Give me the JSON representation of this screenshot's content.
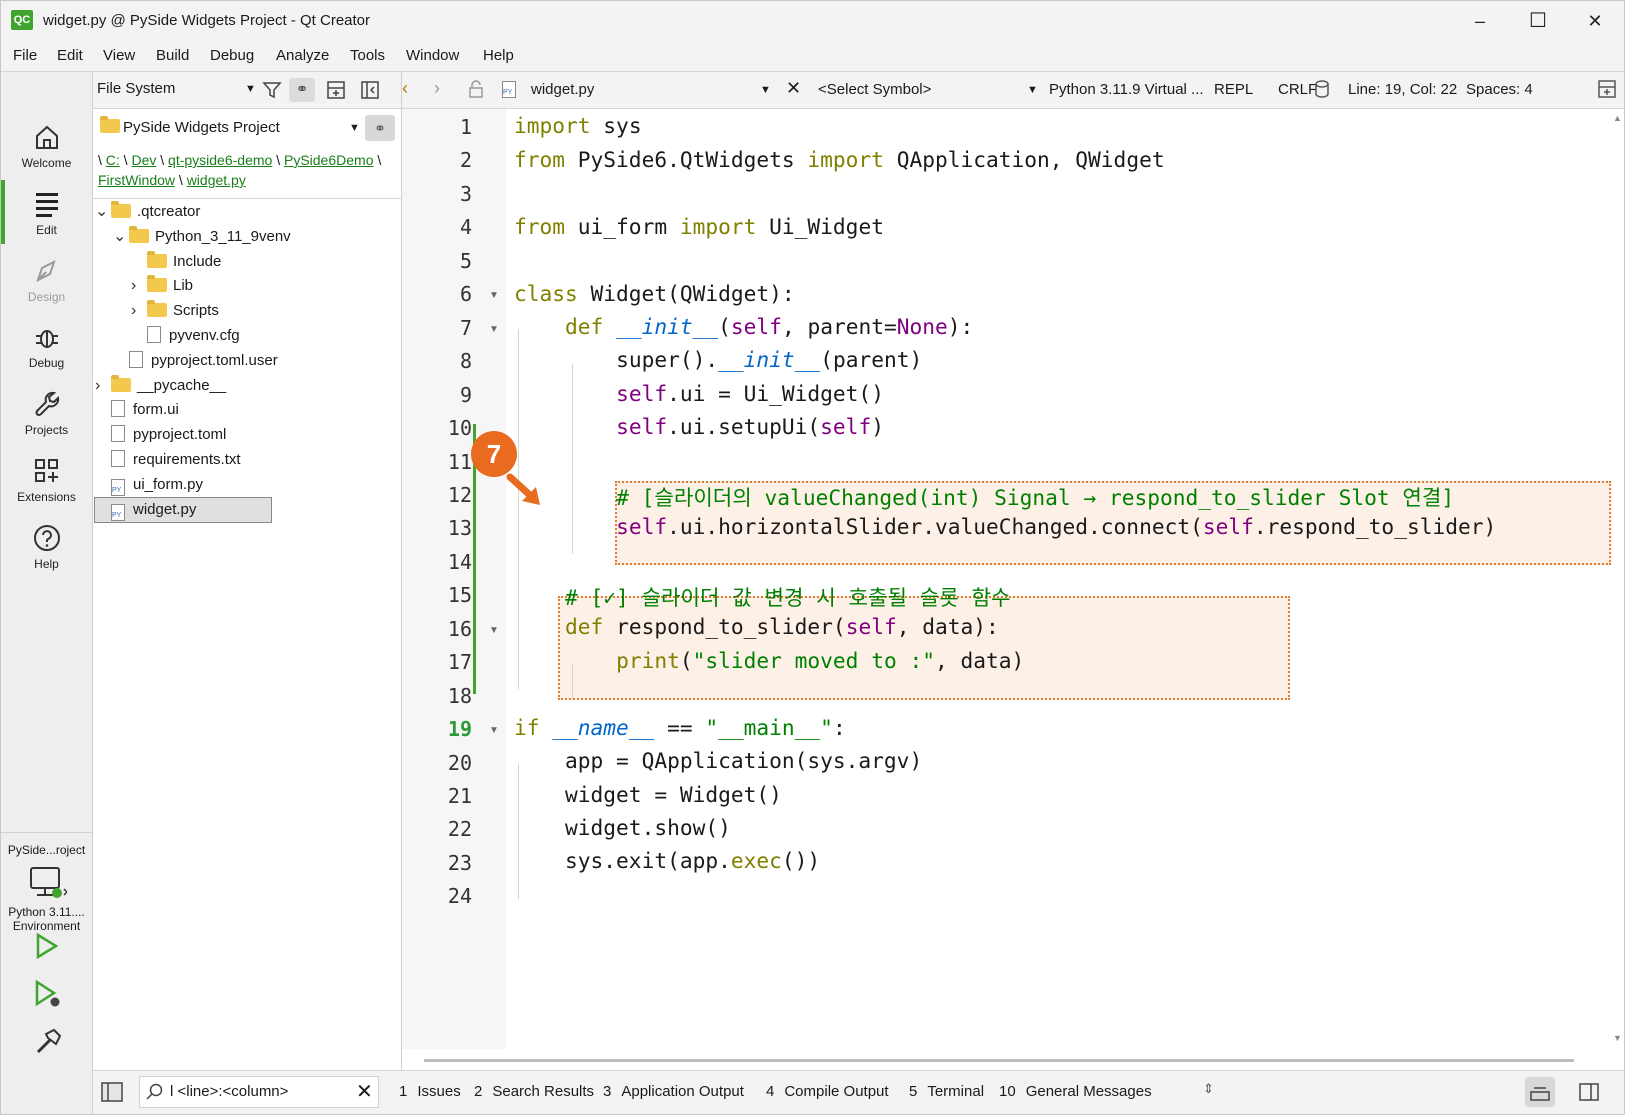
{
  "window": {
    "app_icon": "QC",
    "title": "widget.py @ PySide Widgets Project - Qt Creator",
    "minimize": "–",
    "maximize": "☐",
    "close": "✕"
  },
  "menu": [
    "File",
    "Edit",
    "View",
    "Build",
    "Debug",
    "Analyze",
    "Tools",
    "Window",
    "Help"
  ],
  "modes": [
    {
      "label": "Welcome",
      "icon": "home-icon"
    },
    {
      "label": "Edit",
      "icon": "edit-icon"
    },
    {
      "label": "Design",
      "icon": "design-icon"
    },
    {
      "label": "Debug",
      "icon": "debug-icon"
    },
    {
      "label": "Projects",
      "icon": "wrench-icon"
    },
    {
      "label": "Extensions",
      "icon": "extensions-icon"
    },
    {
      "label": "Help",
      "icon": "help-icon"
    }
  ],
  "target": {
    "project": "PySide...roject",
    "kit_line1": "Python 3.11....",
    "kit_line2": "Environment"
  },
  "sidebar": {
    "view_selector": "File System",
    "project_selector": "PySide Widgets Project",
    "breadcrumb": [
      {
        "label": "\\",
        "link": false
      },
      {
        "label": "C:",
        "link": true
      },
      {
        "label": "\\",
        "link": false
      },
      {
        "label": "Dev",
        "link": true
      },
      {
        "label": "\\",
        "link": false
      },
      {
        "label": "qt-pyside6-demo",
        "link": true
      },
      {
        "label": "\\",
        "link": false
      },
      {
        "label": "PySide6Demo",
        "link": true
      },
      {
        "label": "\\",
        "link": false
      },
      {
        "label": "FirstWindow",
        "link": true
      },
      {
        "label": "\\",
        "link": false
      },
      {
        "label": "widget.py",
        "link": true
      }
    ],
    "tree": [
      {
        "label": ".qtcreator",
        "depth": 0,
        "kind": "folder",
        "expand": "open"
      },
      {
        "label": "Python_3_11_9venv",
        "depth": 1,
        "kind": "folder",
        "expand": "open"
      },
      {
        "label": "Include",
        "depth": 2,
        "kind": "folder",
        "expand": "none"
      },
      {
        "label": "Lib",
        "depth": 2,
        "kind": "folder",
        "expand": "closed"
      },
      {
        "label": "Scripts",
        "depth": 2,
        "kind": "folder",
        "expand": "closed"
      },
      {
        "label": "pyvenv.cfg",
        "depth": 2,
        "kind": "cfg",
        "expand": "none"
      },
      {
        "label": "pyproject.toml.user",
        "depth": 1,
        "kind": "xml",
        "expand": "none"
      },
      {
        "label": "__pycache__",
        "depth": 0,
        "kind": "folder",
        "expand": "closed"
      },
      {
        "label": "form.ui",
        "depth": 0,
        "kind": "ui",
        "expand": "none"
      },
      {
        "label": "pyproject.toml",
        "depth": 0,
        "kind": "text",
        "expand": "none"
      },
      {
        "label": "requirements.txt",
        "depth": 0,
        "kind": "text",
        "expand": "none"
      },
      {
        "label": "ui_form.py",
        "depth": 0,
        "kind": "py",
        "expand": "none"
      },
      {
        "label": "widget.py",
        "depth": 0,
        "kind": "py",
        "expand": "none",
        "selected": true
      }
    ]
  },
  "editor_toolbar": {
    "file": "widget.py",
    "symbol": "<Select Symbol>",
    "interpreter": "Python 3.11.9 Virtual ...",
    "repl": "REPL",
    "line_ending": "CRLF",
    "position": "Line: 19, Col: 22",
    "indent": "Spaces: 4"
  },
  "editor": {
    "line_numbers": [
      "1",
      "2",
      "3",
      "4",
      "5",
      "6",
      "7",
      "8",
      "9",
      "10",
      "11",
      "12",
      "13",
      "14",
      "15",
      "16",
      "17",
      "18",
      "19",
      "20",
      "21",
      "22",
      "23",
      "24"
    ],
    "current_line": "19",
    "callout": "7",
    "code": {
      "l1_kw": "import",
      "l1_rest": " sys",
      "l2_kw1": "from",
      "l2_mid": " PySide6.QtWidgets ",
      "l2_kw2": "import",
      "l2_rest": " QApplication, QWidget",
      "l4_kw1": "from",
      "l4_mid": " ui_form ",
      "l4_kw2": "import",
      "l4_rest": " Ui_Widget",
      "l6_kw": "class",
      "l6_rest": " Widget(QWidget):",
      "l7_kw": "def",
      "l7_sp": " ",
      "l7_fn": "__init__",
      "l7_a": "(",
      "l7_self": "self",
      "l7_b": ", parent=",
      "l7_none": "None",
      "l7_c": "):",
      "l8_a": "super().",
      "l8_fn": "__init__",
      "l8_b": "(parent)",
      "l9_self": "self",
      "l9_rest": ".ui = Ui_Widget()",
      "l10_self": "self",
      "l10_a": ".ui.setupUi(",
      "l10_self2": "self",
      "l10_b": ")",
      "l12": "# [슬라이더의 valueChanged(int) Signal → respond_to_slider Slot 연결]",
      "l13_self": "self",
      "l13_a": ".ui.horizontalSlider.valueChanged.connect(",
      "l13_self2": "self",
      "l13_b": ".respond_to_slider)",
      "l15": "# [✓] 슬라이더 값 변경 시 호출될 슬롯 함수",
      "l16_kw": "def",
      "l16_a": " respond_to_slider(",
      "l16_self": "self",
      "l16_b": ", data):",
      "l17_fn": "print",
      "l17_a": "(",
      "l17_str": "\"slider moved to :\"",
      "l17_b": ", data)",
      "l19_kw": "if",
      "l19_sp": " ",
      "l19_name": "__name__",
      "l19_eq": " == ",
      "l19_str": "\"__main__\"",
      "l19_c": ":",
      "l20": "app = QApplication(sys.argv)",
      "l21": "widget = Widget()",
      "l22": "widget.show()",
      "l23_a": "sys.exit(app.",
      "l23_fn": "exec",
      "l23_b": "())"
    }
  },
  "output_bar": {
    "locator_placeholder": "l <line>:<column>",
    "tabs": [
      {
        "num": "1",
        "label": "Issues"
      },
      {
        "num": "2",
        "label": "Search Results"
      },
      {
        "num": "3",
        "label": "Application Output"
      },
      {
        "num": "4",
        "label": "Compile Output"
      },
      {
        "num": "5",
        "label": "Terminal"
      },
      {
        "num": "10",
        "label": "General Messages"
      }
    ]
  },
  "colors": {
    "accent_green": "#3fa52e",
    "keyword": "#808000",
    "callout_orange": "#e96b1f",
    "highlight_fill": "#fdf1e7"
  }
}
